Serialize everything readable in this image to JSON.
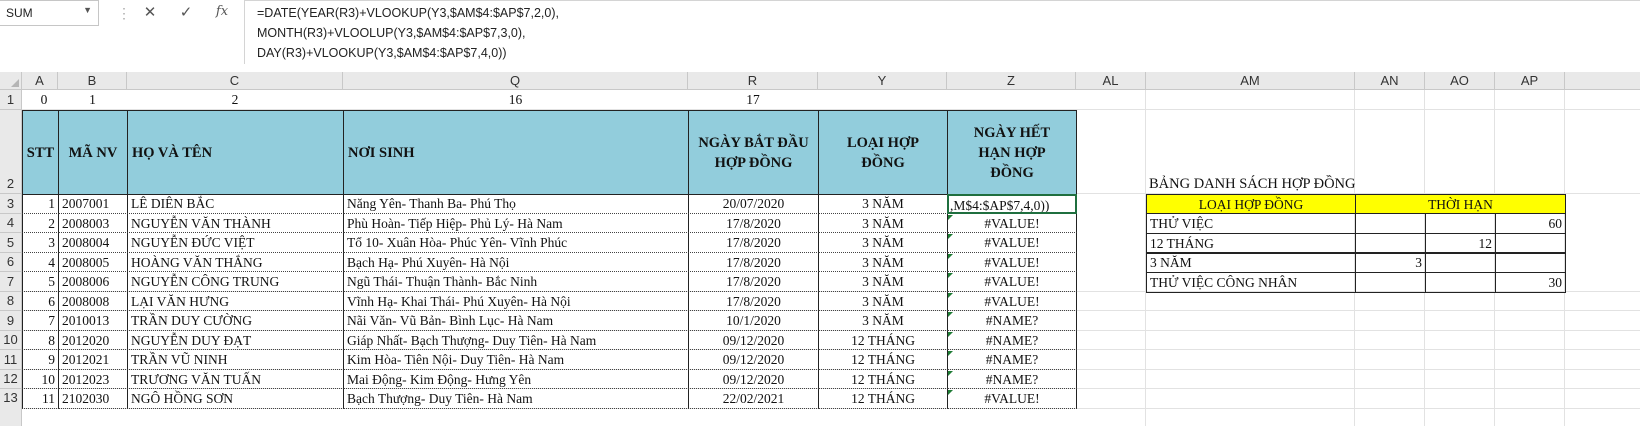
{
  "name_box": {
    "value": "SUM"
  },
  "formula_bar": {
    "cancel_icon": "✕",
    "enter_icon": "✓",
    "fx_label": "fx",
    "lines": [
      "=DATE(YEAR(R3)+VLOOKUP(Y3,$AM$4:$AP$7,2,0),",
      "MONTH(R3)+VLOOLUP(Y3,$AM$4:$AP$7,3,0),",
      "DAY(R3)+VLOOKUP(Y3,$AM$4:$AP$7,4,0))"
    ]
  },
  "columns": [
    "A",
    "B",
    "C",
    "Q",
    "R",
    "Y",
    "Z",
    "AL",
    "AM",
    "AN",
    "AO",
    "AP"
  ],
  "rows": [
    "1",
    "2",
    "3",
    "4",
    "5",
    "6",
    "7",
    "8",
    "9",
    "10",
    "11",
    "12",
    "13"
  ],
  "row1": [
    "0",
    "1",
    "2",
    "16",
    "17"
  ],
  "headers": {
    "stt": "STT",
    "ma_nv": "MÃ NV",
    "ho_ten": "HỌ VÀ TÊN",
    "noi_sinh": "NƠI SINH",
    "ngay_bat_dau": "NGÀY BẮT ĐẦU HỢP ĐỒNG",
    "loai_hop_dong": "LOẠI HỢP ĐỒNG",
    "ngay_het_han": "NGÀY HẾT HẠN HỢP ĐỒNG"
  },
  "employees": [
    {
      "stt": "1",
      "ma": "2007001",
      "ten": "LÊ DIÊN BẮC",
      "noi_sinh": "Năng Yên- Thanh Ba- Phú Thọ",
      "ngay": "20/07/2020",
      "loai": "3 NĂM",
      "het_han": ",M$4:$AP$7,4,0))"
    },
    {
      "stt": "2",
      "ma": "2008003",
      "ten": "NGUYỄN VĂN THÀNH",
      "noi_sinh": "Phù Hoàn- Tiếp Hiệp- Phủ Lý- Hà Nam",
      "ngay": "17/8/2020",
      "loai": "3 NĂM",
      "het_han": "#VALUE!"
    },
    {
      "stt": "3",
      "ma": "2008004",
      "ten": "NGUYỄN ĐỨC VIỆT",
      "noi_sinh": "Tổ 10- Xuân Hòa- Phúc Yên- Vĩnh Phúc",
      "ngay": "17/8/2020",
      "loai": "3 NĂM",
      "het_han": "#VALUE!"
    },
    {
      "stt": "4",
      "ma": "2008005",
      "ten": "HOÀNG VĂN THẮNG",
      "noi_sinh": "Bạch Hạ- Phú Xuyên- Hà Nội",
      "ngay": "17/8/2020",
      "loai": "3 NĂM",
      "het_han": "#VALUE!"
    },
    {
      "stt": "5",
      "ma": "2008006",
      "ten": "NGUYỄN CÔNG TRUNG",
      "noi_sinh": "Ngũ Thái- Thuận Thành- Bắc Ninh",
      "ngay": "17/8/2020",
      "loai": "3 NĂM",
      "het_han": "#VALUE!"
    },
    {
      "stt": "6",
      "ma": "2008008",
      "ten": "LẠI VĂN HƯNG",
      "noi_sinh": "Vĩnh Hạ- Khai Thái- Phú Xuyên- Hà Nội",
      "ngay": "17/8/2020",
      "loai": "3 NĂM",
      "het_han": "#VALUE!"
    },
    {
      "stt": "7",
      "ma": "2010013",
      "ten": "TRẦN DUY CƯỜNG",
      "noi_sinh": "Nãi Văn- Vũ Bản- Bình Lục- Hà Nam",
      "ngay": "10/1/2020",
      "loai": "3 NĂM",
      "het_han": "#NAME?"
    },
    {
      "stt": "8",
      "ma": "2012020",
      "ten": "NGUYỄN DUY ĐẠT",
      "noi_sinh": "Giáp Nhất- Bạch Thượng- Duy Tiên- Hà Nam",
      "ngay": "09/12/2020",
      "loai": "12 THÁNG",
      "het_han": "#NAME?"
    },
    {
      "stt": "9",
      "ma": "2012021",
      "ten": "TRẦN VŨ NINH",
      "noi_sinh": "Kim Hòa- Tiên Nội- Duy Tiên- Hà Nam",
      "ngay": "09/12/2020",
      "loai": "12 THÁNG",
      "het_han": "#NAME?"
    },
    {
      "stt": "10",
      "ma": "2012023",
      "ten": "TRƯƠNG VĂN TUẤN",
      "noi_sinh": "Mai Động- Kim Động- Hưng Yên",
      "ngay": "09/12/2020",
      "loai": "12 THÁNG",
      "het_han": "#NAME?"
    },
    {
      "stt": "11",
      "ma": "2102030",
      "ten": "NGÔ HỒNG SƠN",
      "noi_sinh": "Bạch Thượng- Duy Tiên- Hà Nam",
      "ngay": "22/02/2021",
      "loai": "12 THÁNG",
      "het_han": "#VALUE!"
    }
  ],
  "contract_table": {
    "title": "BẢNG DANH SÁCH HỢP ĐỒNG",
    "col1_header": "LOẠI HỢP ĐỒNG",
    "col2_header": "THỜI HẠN",
    "rows": [
      {
        "name": "THỬ VIỆC",
        "an": "",
        "ao": "",
        "ap": "60"
      },
      {
        "name": "12 THÁNG",
        "an": "",
        "ao": "12",
        "ap": ""
      },
      {
        "name": "3 NĂM",
        "an": "3",
        "ao": "",
        "ap": ""
      },
      {
        "name": "THỬ VIỆC CÔNG NHÂN",
        "an": "",
        "ao": "",
        "ap": "30"
      }
    ]
  },
  "colors": {
    "header_fill": "#92cddc",
    "yellow": "#ffff00",
    "error_triangle": "#1e7b34"
  }
}
